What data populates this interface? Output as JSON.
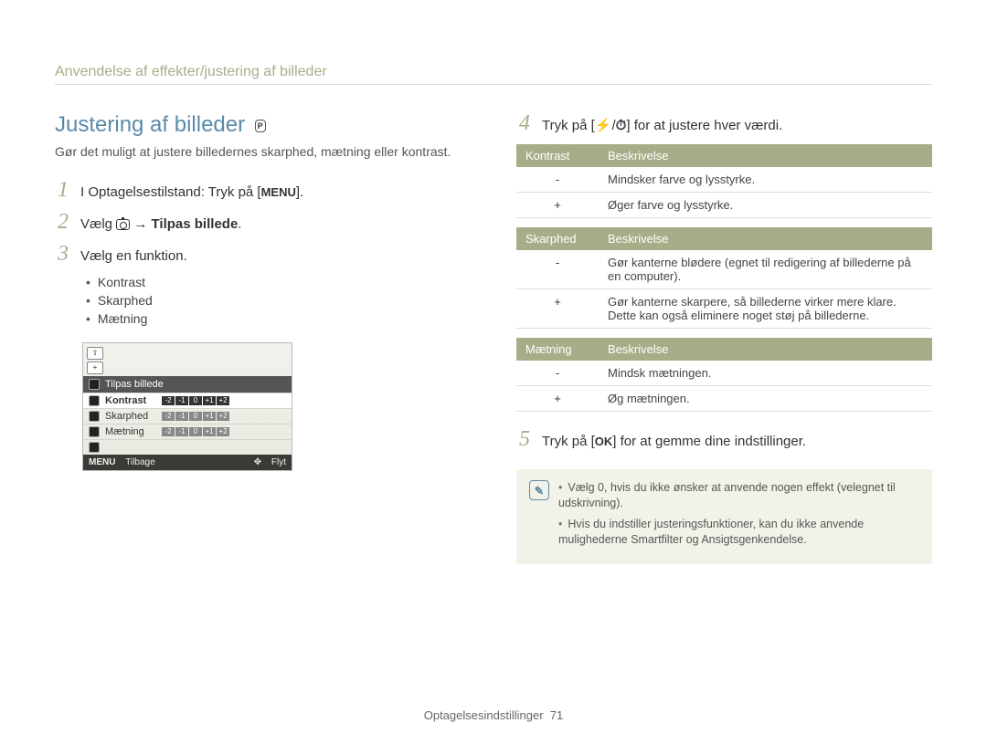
{
  "breadcrumb": "Anvendelse af effekter/justering af billeder",
  "page_title": "Justering af billeder",
  "mode_badge": "P",
  "intro": "Gør det muligt at justere billedernes skarphed, mætning eller kontrast.",
  "steps": {
    "s1": {
      "num": "1",
      "prefix": "I Optagelsestilstand: Tryk på [",
      "key": "MENU",
      "suffix": "]."
    },
    "s2": {
      "num": "2",
      "prefix": "Vælg ",
      "arrow": " → ",
      "bold": "Tilpas billede",
      "suffix": "."
    },
    "s3": {
      "num": "3",
      "text": "Vælg en funktion.",
      "bullets": [
        "Kontrast",
        "Skarphed",
        "Mætning"
      ]
    },
    "s4": {
      "num": "4",
      "prefix": "Tryk på [",
      "key1": "⚡",
      "sep": "/",
      "key2": "⏱",
      "suffix": "] for at justere hver værdi."
    },
    "s5": {
      "num": "5",
      "prefix": "Tryk på [",
      "key": "OK",
      "suffix": "] for at gemme dine indstillinger."
    }
  },
  "lcd": {
    "title": "Tilpas billede",
    "rows": [
      {
        "label": "Kontrast",
        "selected": true
      },
      {
        "label": "Skarphed",
        "selected": false
      },
      {
        "label": "Mætning",
        "selected": false
      }
    ],
    "ticks": [
      "-2",
      "-1",
      "0",
      "+1",
      "+2"
    ],
    "foot_left_key": "MENU",
    "foot_left": "Tilbage",
    "foot_right": "Flyt"
  },
  "tables": {
    "kontrast": {
      "h1": "Kontrast",
      "h2": "Beskrivelse",
      "rows": [
        {
          "k": "-",
          "v": "Mindsker farve og lysstyrke."
        },
        {
          "k": "+",
          "v": "Øger farve og lysstyrke."
        }
      ]
    },
    "skarphed": {
      "h1": "Skarphed",
      "h2": "Beskrivelse",
      "rows": [
        {
          "k": "-",
          "v": "Gør kanterne blødere (egnet til redigering af billederne på en computer)."
        },
        {
          "k": "+",
          "v": "Gør kanterne skarpere, så billederne virker mere klare. Dette kan også eliminere noget støj på billederne."
        }
      ]
    },
    "maetning": {
      "h1": "Mætning",
      "h2": "Beskrivelse",
      "rows": [
        {
          "k": "-",
          "v": "Mindsk mætningen."
        },
        {
          "k": "+",
          "v": "Øg mætningen."
        }
      ]
    }
  },
  "notes": [
    "Vælg 0, hvis du ikke ønsker at anvende nogen effekt (velegnet til udskrivning).",
    "Hvis du indstiller justeringsfunktioner, kan du ikke anvende mulighederne Smartfilter og Ansigtsgenkendelse."
  ],
  "footer": {
    "section": "Optagelsesindstillinger",
    "page": "71"
  }
}
